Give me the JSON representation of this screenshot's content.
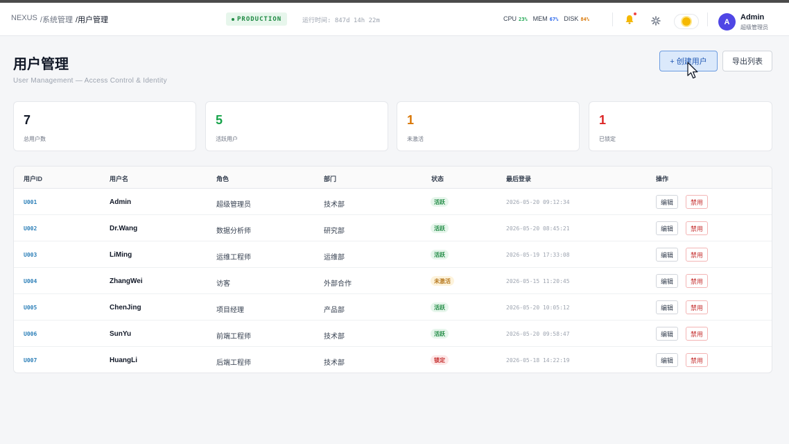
{
  "breadcrumb": {
    "root": "NEXUS",
    "section": "/系统管理",
    "current": "/用户管理"
  },
  "env_badge": {
    "label": "PRODUCTION"
  },
  "uptime": "运行时间: 847d 14h 22m",
  "metrics": [
    {
      "name": "CPU",
      "value": "23%",
      "color": "#16a34a"
    },
    {
      "name": "MEM",
      "value": "67%",
      "color": "#2563eb"
    },
    {
      "name": "DISK",
      "value": "84%",
      "color": "#d97706"
    }
  ],
  "user": {
    "initial": "A",
    "name": "Admin",
    "role": "超级管理员"
  },
  "page": {
    "title": "用户管理",
    "subtitle": "User Management — Access Control & Identity",
    "create_label": "+ 创建用户",
    "export_label": "导出列表"
  },
  "stats": [
    {
      "value": "7",
      "label": "总用户数",
      "color": "#111827"
    },
    {
      "value": "5",
      "label": "活跃用户",
      "color": "#16a34a"
    },
    {
      "value": "1",
      "label": "未激活",
      "color": "#d97706"
    },
    {
      "value": "1",
      "label": "已锁定",
      "color": "#dc2626"
    }
  ],
  "table": {
    "headers": [
      "用户ID",
      "用户名",
      "角色",
      "部门",
      "状态",
      "最后登录",
      "操作"
    ],
    "edit_label": "编辑",
    "ban_label": "禁用",
    "rows": [
      {
        "id": "U001",
        "name": "Admin",
        "role": "超级管理员",
        "dept": "技术部",
        "status": "活跃",
        "status_type": "active",
        "last_login": "2026-05-20 09:12:34"
      },
      {
        "id": "U002",
        "name": "Dr.Wang",
        "role": "数据分析师",
        "dept": "研究部",
        "status": "活跃",
        "status_type": "active",
        "last_login": "2026-05-20 08:45:21"
      },
      {
        "id": "U003",
        "name": "LiMing",
        "role": "运维工程师",
        "dept": "运维部",
        "status": "活跃",
        "status_type": "active",
        "last_login": "2026-05-19 17:33:08"
      },
      {
        "id": "U004",
        "name": "ZhangWei",
        "role": "访客",
        "dept": "外部合作",
        "status": "未激活",
        "status_type": "inactive",
        "last_login": "2026-05-15 11:20:45"
      },
      {
        "id": "U005",
        "name": "ChenJing",
        "role": "项目经理",
        "dept": "产品部",
        "status": "活跃",
        "status_type": "active",
        "last_login": "2026-05-20 10:05:12"
      },
      {
        "id": "U006",
        "name": "SunYu",
        "role": "前端工程师",
        "dept": "技术部",
        "status": "活跃",
        "status_type": "active",
        "last_login": "2026-05-20 09:58:47"
      },
      {
        "id": "U007",
        "name": "HuangLi",
        "role": "后端工程师",
        "dept": "技术部",
        "status": "锁定",
        "status_type": "locked",
        "last_login": "2026-05-18 14:22:19"
      }
    ]
  }
}
